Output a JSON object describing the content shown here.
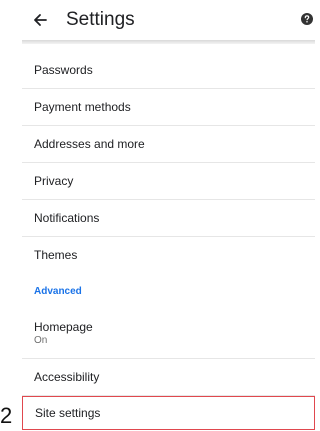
{
  "header": {
    "title": "Settings",
    "back_icon": "arrow-left-icon",
    "help_icon": "help-icon"
  },
  "items": [
    {
      "label": "Passwords"
    },
    {
      "label": "Payment methods"
    },
    {
      "label": "Addresses and more"
    },
    {
      "label": "Privacy"
    },
    {
      "label": "Notifications"
    },
    {
      "label": "Themes"
    }
  ],
  "advanced": {
    "header": "Advanced",
    "homepage": {
      "label": "Homepage",
      "sub": "On"
    },
    "accessibility": {
      "label": "Accessibility"
    },
    "site_settings": {
      "label": "Site settings"
    }
  },
  "annotation": {
    "step": "2"
  },
  "colors": {
    "accent": "#1a73e8",
    "highlight_border": "#e0484e"
  }
}
